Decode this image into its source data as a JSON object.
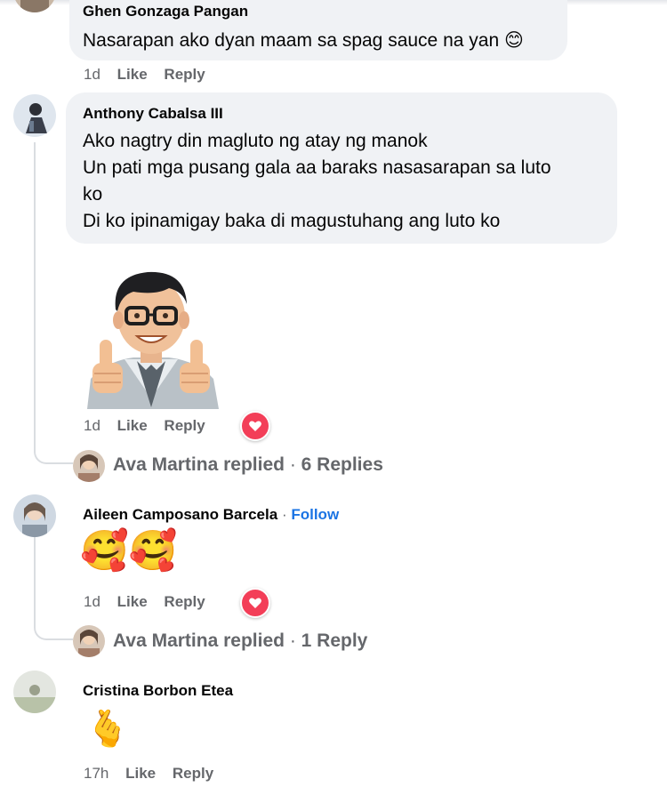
{
  "comments": [
    {
      "author": "Ghen Gonzaga Pangan",
      "lines": [
        "Nasarapan ako dyan maam sa spag sauce na yan"
      ],
      "emoji": "😊",
      "time": "1d",
      "like": "Like",
      "reply": "Reply"
    },
    {
      "author": "Anthony Cabalsa III",
      "lines": [
        "Ako nagtry din magluto ng atay ng manok",
        "Un pati mga pusang gala aa baraks nasasarapan sa luto",
        "ko",
        "Di ko ipinamigay baka di magustuhang ang luto ko"
      ],
      "sticker": "thumbs-up-avatar-sticker",
      "time": "1d",
      "like": "Like",
      "reply": "Reply",
      "reaction": "love",
      "replies": {
        "name": "Ava Martina",
        "text": "replied",
        "count": "6 Replies"
      }
    },
    {
      "author": "Aileen Camposano Barcela",
      "follow": "Follow",
      "emoji": "🥰🥰",
      "time": "1d",
      "like": "Like",
      "reply": "Reply",
      "reaction": "love",
      "replies": {
        "name": "Ava Martina",
        "text": "replied",
        "count": "1 Reply"
      }
    },
    {
      "author": "Cristina Borbon Etea",
      "emoji": "🫰",
      "time": "17h",
      "like": "Like",
      "reply": "Reply"
    }
  ],
  "colors": {
    "bubble": "#f0f2f5",
    "meta": "#65676b",
    "follow": "#1b74e4",
    "love": "#f33e58"
  }
}
